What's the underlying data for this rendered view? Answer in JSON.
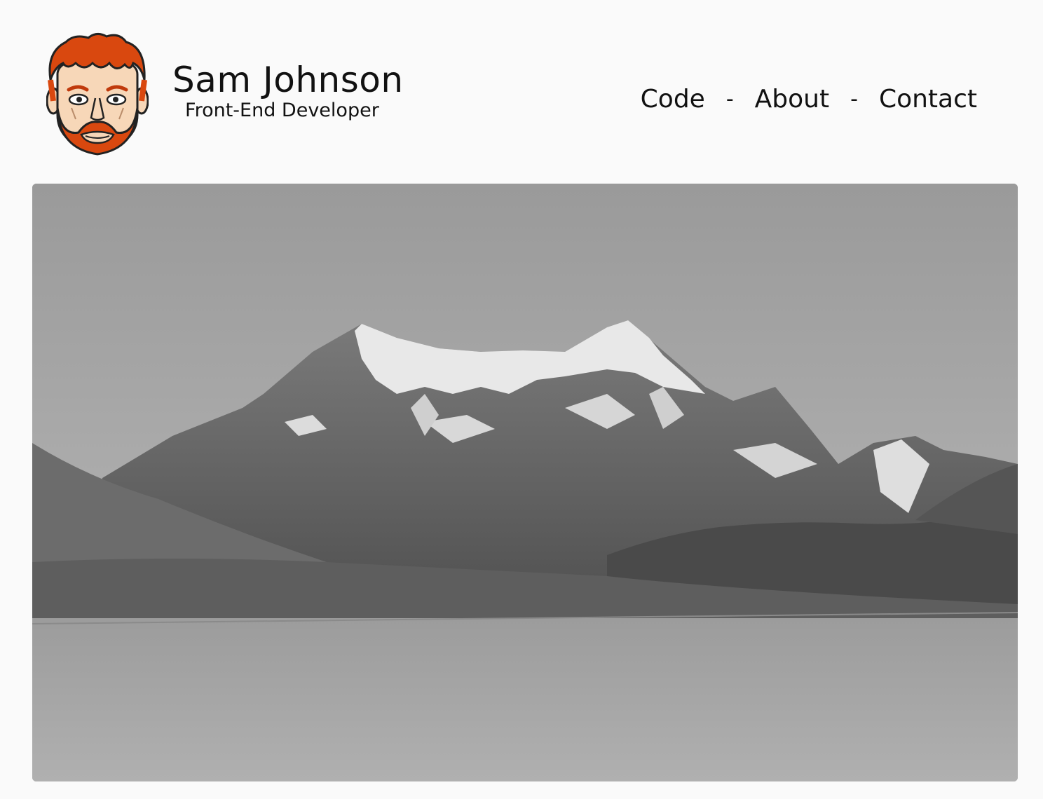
{
  "header": {
    "name": "Sam Johnson",
    "role": "Front-End Developer"
  },
  "nav": {
    "items": [
      {
        "label": "Code"
      },
      {
        "label": "About"
      },
      {
        "label": "Contact"
      }
    ],
    "separator": "-"
  },
  "colors": {
    "background": "#fafafa",
    "text": "#111111",
    "avatar_hair": "#d9480f"
  },
  "icons": {
    "avatar": "cartoon-face-icon"
  },
  "hero": {
    "subject": "mountain-landscape-image"
  }
}
